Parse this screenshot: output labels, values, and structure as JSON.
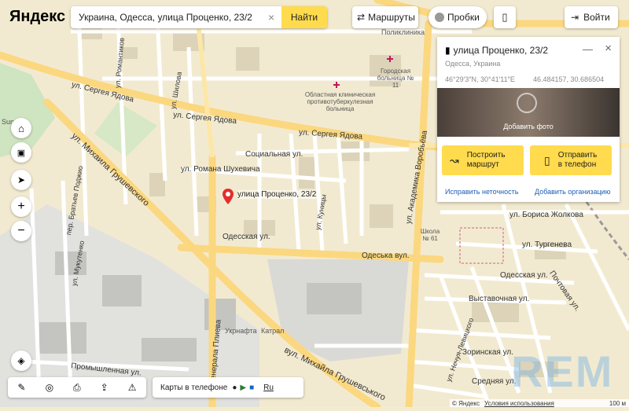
{
  "brand": {
    "logo": "Яндекс"
  },
  "search": {
    "value": "Украина, Одесса, улица Проценко, 23/2",
    "button": "Найти"
  },
  "toolbar": {
    "routes": "Маршруты",
    "traffic": "Пробки",
    "login": "Войти"
  },
  "card": {
    "title": "улица Проценко, 23/2",
    "subtitle": "Одесса, Украина",
    "coords_dms": "46°29′3″N, 30°41′11″E",
    "coords_dec": "46.484157, 30.686504",
    "add_photo": "Добавить фото",
    "route_btn_line1": "Построить",
    "route_btn_line2": "маршрут",
    "phone_btn_line1": "Отправить",
    "phone_btn_line2": "в телефон",
    "fix_link": "Исправить неточность",
    "add_org_link": "Добавить организацию"
  },
  "marker": {
    "label": "улица Проценко, 23/2"
  },
  "streets": [
    {
      "text": "ул. Сергея Ядова"
    },
    {
      "text": "ул. Сергея Ядова"
    },
    {
      "text": "ул. Сергея Ядова"
    },
    {
      "text": "ул. Михаила Грушевского"
    },
    {
      "text": "Социальная ул."
    },
    {
      "text": "ул. Романа Шухевича"
    },
    {
      "text": "Одесская ул."
    },
    {
      "text": "Одесская ул."
    },
    {
      "text": "Одеська вул."
    },
    {
      "text": "ул. Академика Воробьёва"
    },
    {
      "text": "ул. Бориса Жолкова"
    },
    {
      "text": "ул. Тургенева"
    },
    {
      "text": "Выставочная ул."
    },
    {
      "text": "Почтовая ул."
    },
    {
      "text": "ул. Генерала Плиева"
    },
    {
      "text": "Промышленная ул."
    },
    {
      "text": "вул. Михайла Грушевського"
    },
    {
      "text": "ул. Нечуя-Левицкого"
    },
    {
      "text": "Зоринская ул."
    },
    {
      "text": "Средняя ул."
    },
    {
      "text": "ул. Шилова"
    },
    {
      "text": "ул. Куницы"
    },
    {
      "text": "ул. Романтиков"
    },
    {
      "text": "пер. Братьев Поджио"
    },
    {
      "text": "ул. Мукутенко"
    }
  ],
  "pois": [
    {
      "text": "Поликлиника"
    },
    {
      "text": "Городская больница № 11"
    },
    {
      "text": "Областная клиническая противотуберкулезная больница"
    },
    {
      "text": "Школа № 61"
    },
    {
      "text": "Укрнафта"
    },
    {
      "text": "Катрал"
    },
    {
      "text": "Sun"
    }
  ],
  "bottom": {
    "phone_maps": "Карты в телефоне",
    "lang": "Ru"
  },
  "footer": {
    "copyright": "© Яндекс",
    "terms": "Условия использования",
    "scale": "100 м"
  },
  "watermark": "REM",
  "colors": {
    "accent": "#ffdb4d",
    "road": "#fddf8f",
    "marker": "#e52d2d"
  }
}
